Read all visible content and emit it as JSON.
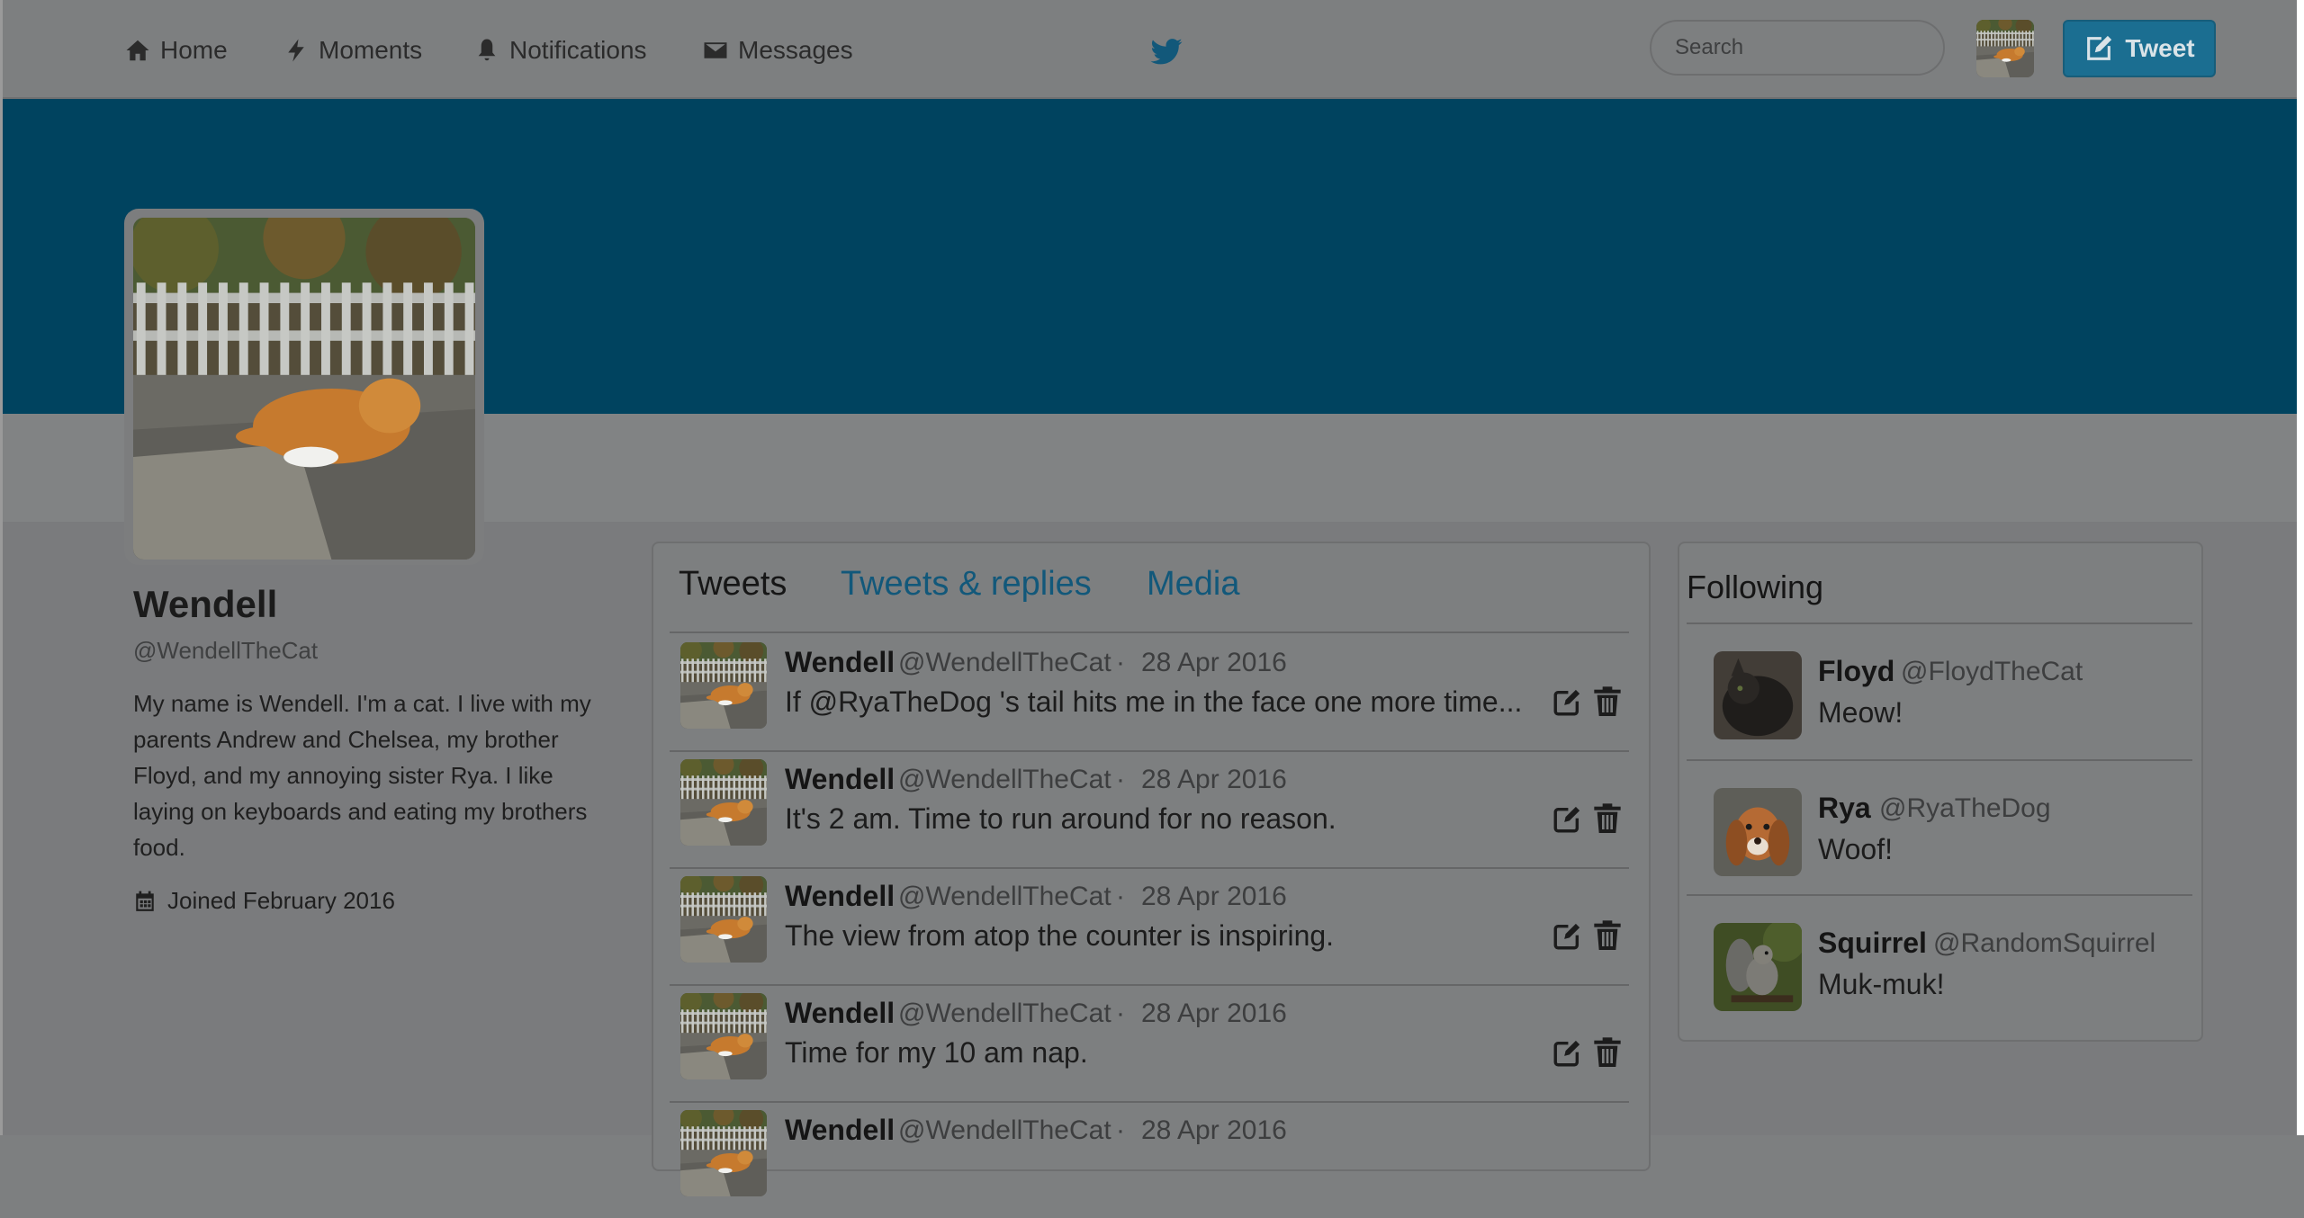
{
  "nav": {
    "home_label": "Home",
    "moments_label": "Moments",
    "notifications_label": "Notifications",
    "messages_label": "Messages",
    "search_placeholder": "Search",
    "tweet_button_label": "Tweet"
  },
  "profile": {
    "name": "Wendell",
    "handle": "@WendellTheCat",
    "bio": "My name is Wendell. I'm a cat. I live with my parents Andrew and Chelsea, my brother Floyd, and my annoying sister Rya. I like laying on keyboards and eating my brothers food.",
    "joined": "Joined February 2016"
  },
  "tabs": {
    "tweets": "Tweets",
    "tweets_replies": "Tweets & replies",
    "media": "Media"
  },
  "tweets": [
    {
      "author": "Wendell",
      "handle": "@WendellTheCat",
      "date": "28 Apr 2016",
      "text": "If @RyaTheDog 's tail hits me in the face one more time..."
    },
    {
      "author": "Wendell",
      "handle": "@WendellTheCat",
      "date": "28 Apr 2016",
      "text": "It's 2 am. Time to run around for no reason."
    },
    {
      "author": "Wendell",
      "handle": "@WendellTheCat",
      "date": "28 Apr 2016",
      "text": "The view from atop the counter is inspiring."
    },
    {
      "author": "Wendell",
      "handle": "@WendellTheCat",
      "date": "28 Apr 2016",
      "text": "Time for my 10 am nap."
    },
    {
      "author": "Wendell",
      "handle": "@WendellTheCat",
      "date": "28 Apr 2016",
      "text": ""
    }
  ],
  "following": {
    "title": "Following",
    "items": [
      {
        "name": "Floyd",
        "handle": "@FloydTheCat",
        "status": "Meow!"
      },
      {
        "name": "Rya",
        "handle": "@RyaTheDog",
        "status": "Woof!"
      },
      {
        "name": "Squirrel",
        "handle": "@RandomSquirrel",
        "status": "Muk-muk!"
      }
    ]
  },
  "icons": {
    "home": "home-icon",
    "moments": "bolt-icon",
    "notifications": "bell-icon",
    "messages": "envelope-icon",
    "brand": "twitter-bird-icon",
    "compose": "compose-icon",
    "calendar": "calendar-icon",
    "edit": "edit-icon",
    "delete": "trash-icon"
  },
  "colors": {
    "banner": "#00435f",
    "link": "#12587a",
    "button": "#1b6e91",
    "overlay_tint": "#7d7f80"
  }
}
